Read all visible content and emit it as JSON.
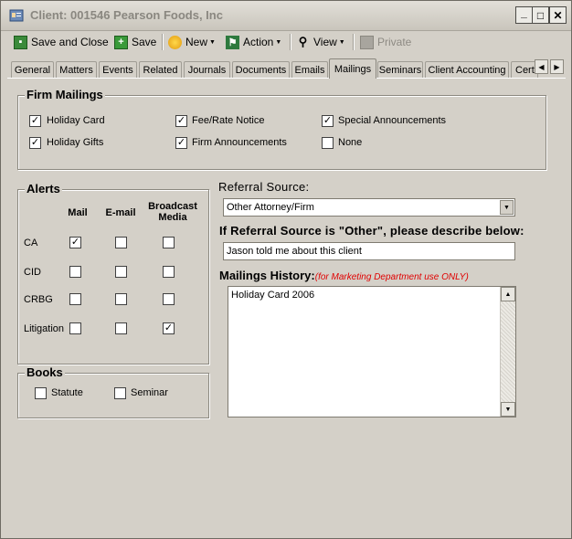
{
  "window": {
    "title": "Client: 001546 Pearson Foods, Inc",
    "minimize": "_",
    "maximize": "□",
    "close": "✕"
  },
  "toolbar": {
    "save_close": "Save and Close",
    "save": "Save",
    "new": "New",
    "action": "Action",
    "view": "View",
    "private": "Private"
  },
  "tabs": [
    "General",
    "Matters",
    "Events",
    "Related",
    "Journals",
    "Documents",
    "Emails",
    "Mailings",
    "Seminars",
    "Client Accounting",
    "Cert"
  ],
  "active_tab": "Mailings",
  "firm_mailings": {
    "legend": "Firm Mailings",
    "items": [
      {
        "label": "Holiday Card",
        "checked": true
      },
      {
        "label": "Holiday Gifts",
        "checked": true
      },
      {
        "label": "Fee/Rate Notice",
        "checked": true
      },
      {
        "label": "Firm Announcements",
        "checked": true
      },
      {
        "label": "Special Announcements",
        "checked": true
      },
      {
        "label": "None",
        "checked": false
      }
    ]
  },
  "alerts": {
    "legend": "Alerts",
    "columns": [
      "Mail",
      "E-mail",
      "Broadcast Media"
    ],
    "rows": [
      {
        "label": "CA",
        "values": [
          true,
          false,
          false
        ]
      },
      {
        "label": "CID",
        "values": [
          false,
          false,
          false
        ]
      },
      {
        "label": "CRBG",
        "values": [
          false,
          false,
          false
        ]
      },
      {
        "label": "Litigation",
        "values": [
          false,
          false,
          true
        ]
      }
    ]
  },
  "books": {
    "legend": "Books",
    "items": [
      {
        "label": "Statute",
        "checked": false
      },
      {
        "label": "Seminar",
        "checked": false
      }
    ]
  },
  "referral": {
    "label": "Referral Source:",
    "value": "Other Attorney/Firm",
    "other_label": "If Referral Source is \"Other\", please describe below:",
    "other_value": "Jason told me about this client"
  },
  "mailings_history": {
    "label": "Mailings History:",
    "note": "(for Marketing Department use ONLY)",
    "note_color": "#e00000",
    "value": "Holiday Card 2006"
  },
  "check_glyph": "✓"
}
